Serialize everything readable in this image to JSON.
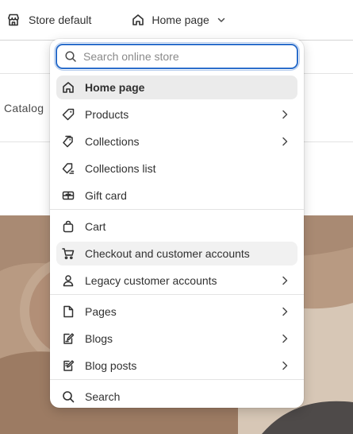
{
  "topbar": {
    "store_label": "Store default",
    "page_label": "Home page"
  },
  "background": {
    "nav_text": "Catalog"
  },
  "dropdown": {
    "search": {
      "placeholder": "Search online store",
      "value": ""
    },
    "items": [
      {
        "label": "Home page",
        "icon": "home-icon",
        "state": "selected",
        "submenu": false
      },
      {
        "label": "Products",
        "icon": "tag-icon",
        "state": "",
        "submenu": true
      },
      {
        "label": "Collections",
        "icon": "collection-icon",
        "state": "",
        "submenu": true
      },
      {
        "label": "Collections list",
        "icon": "collection-list-icon",
        "state": "",
        "submenu": false
      },
      {
        "label": "Gift card",
        "icon": "gift-card-icon",
        "state": "",
        "submenu": false
      },
      {
        "label": "Cart",
        "icon": "cart-icon",
        "state": "",
        "submenu": false
      },
      {
        "label": "Checkout and customer accounts",
        "icon": "checkout-icon",
        "state": "hover",
        "submenu": false
      },
      {
        "label": "Legacy customer accounts",
        "icon": "person-icon",
        "state": "",
        "submenu": true
      },
      {
        "label": "Pages",
        "icon": "page-icon",
        "state": "",
        "submenu": true
      },
      {
        "label": "Blogs",
        "icon": "blog-icon",
        "state": "",
        "submenu": true
      },
      {
        "label": "Blog posts",
        "icon": "blog-post-icon",
        "state": "",
        "submenu": true
      },
      {
        "label": "Search",
        "icon": "search-icon",
        "state": "",
        "submenu": false
      }
    ]
  },
  "colors": {
    "focus_ring": "#2c6ecb",
    "selected_bg": "#ebebeb",
    "hover_bg": "#f1f1f1",
    "hero_bg": "#a98a73",
    "text": "#303030"
  }
}
